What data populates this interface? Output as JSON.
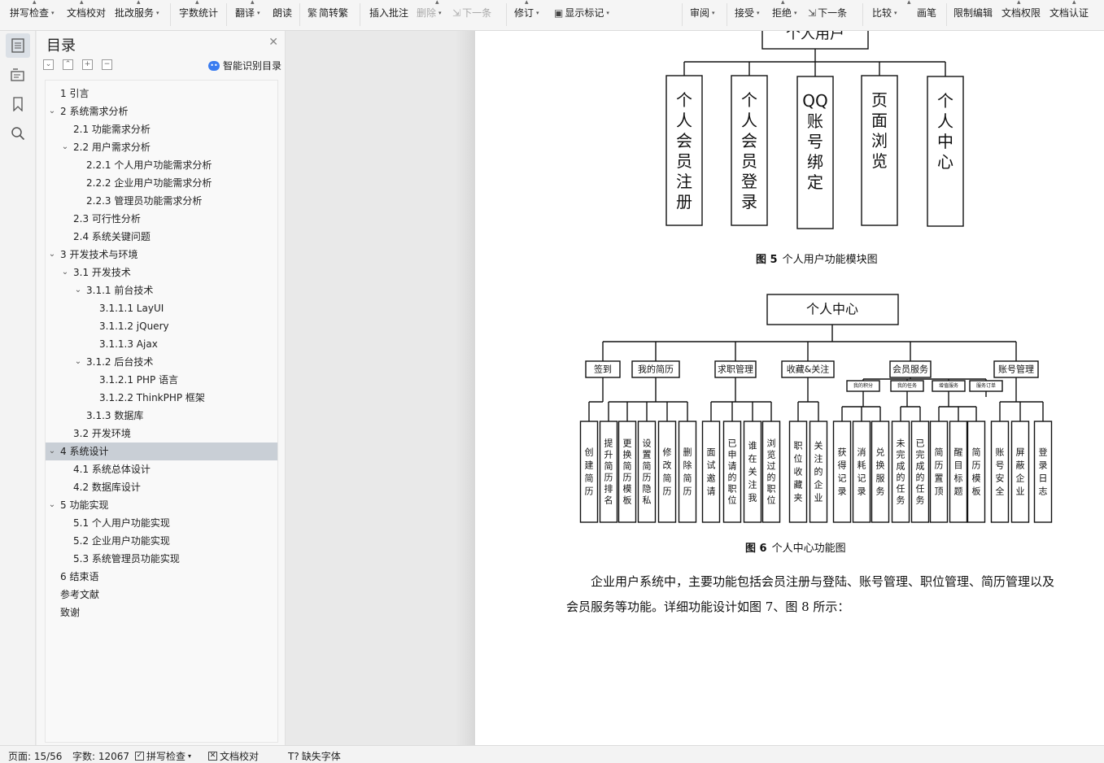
{
  "toolbar": {
    "items": [
      {
        "label": "拼写检查",
        "caret": true,
        "icon": "spellcheck-icon"
      },
      {
        "label": "文档校对",
        "caret": false,
        "icon": "proofread-icon"
      },
      {
        "label": "批改服务",
        "caret": true,
        "icon": "correction-icon"
      },
      {
        "label": "字数统计",
        "caret": false,
        "icon": "wordcount-icon"
      },
      {
        "label": "翻译",
        "caret": true,
        "icon": "translate-icon"
      },
      {
        "label": "朗读",
        "caret": false,
        "icon": "read-aloud-icon"
      },
      {
        "label": "简转繁",
        "caret": false,
        "icon": "simp-trad-icon"
      },
      {
        "label": "插入批注",
        "caret": false,
        "icon": "insert-comment-icon"
      },
      {
        "label": "删除",
        "caret": true,
        "icon": "delete-comment-icon",
        "disabled": true
      },
      {
        "label": "下一条",
        "caret": false,
        "icon": "next-comment-icon",
        "disabled": true
      },
      {
        "label": "修订",
        "caret": true,
        "icon": "revise-icon"
      },
      {
        "label": "显示标记",
        "caret": true,
        "icon": "show-markup-icon"
      },
      {
        "label": "审阅",
        "caret": true,
        "icon": "review-icon"
      },
      {
        "label": "接受",
        "caret": true,
        "icon": "accept-icon"
      },
      {
        "label": "拒绝",
        "caret": true,
        "icon": "reject-icon"
      },
      {
        "label": "下一条",
        "caret": false,
        "icon": "next-change-icon"
      },
      {
        "label": "比较",
        "caret": true,
        "icon": "compare-icon"
      },
      {
        "label": "画笔",
        "caret": false,
        "icon": "pen-icon"
      },
      {
        "label": "限制编辑",
        "caret": false,
        "icon": "restrict-edit-icon"
      },
      {
        "label": "文档权限",
        "caret": false,
        "icon": "doc-permission-icon"
      },
      {
        "label": "文档认证",
        "caret": false,
        "icon": "doc-certify-icon"
      }
    ]
  },
  "rail": {
    "buttons": [
      "toc-icon",
      "outline-icon",
      "bookmark-icon",
      "search-icon"
    ]
  },
  "toc": {
    "title": "目录",
    "smart_label": "智能识别目录",
    "items": [
      {
        "label": "1 引言",
        "level": 0,
        "chev": false
      },
      {
        "label": "2 系统需求分析",
        "level": 0,
        "chev": true
      },
      {
        "label": "2.1 功能需求分析",
        "level": 1,
        "chev": false
      },
      {
        "label": "2.2 用户需求分析",
        "level": 1,
        "chev": true
      },
      {
        "label": "2.2.1 个人用户功能需求分析",
        "level": 2,
        "chev": false
      },
      {
        "label": "2.2.2 企业用户功能需求分析",
        "level": 2,
        "chev": false
      },
      {
        "label": "2.2.3 管理员功能需求分析",
        "level": 2,
        "chev": false
      },
      {
        "label": "2.3 可行性分析",
        "level": 1,
        "chev": false
      },
      {
        "label": "2.4 系统关键问题",
        "level": 1,
        "chev": false
      },
      {
        "label": "3 开发技术与环境",
        "level": 0,
        "chev": true
      },
      {
        "label": "3.1 开发技术",
        "level": 1,
        "chev": true
      },
      {
        "label": "3.1.1 前台技术",
        "level": 2,
        "chev": true
      },
      {
        "label": "3.1.1.1 LayUI",
        "level": 3,
        "chev": false
      },
      {
        "label": "3.1.1.2 jQuery",
        "level": 3,
        "chev": false
      },
      {
        "label": "3.1.1.3 Ajax",
        "level": 3,
        "chev": false
      },
      {
        "label": "3.1.2 后台技术",
        "level": 2,
        "chev": true
      },
      {
        "label": "3.1.2.1 PHP 语言",
        "level": 3,
        "chev": false
      },
      {
        "label": "3.1.2.2 ThinkPHP 框架",
        "level": 3,
        "chev": false
      },
      {
        "label": "3.1.3 数据库",
        "level": 2,
        "chev": false
      },
      {
        "label": "3.2 开发环境",
        "level": 1,
        "chev": false
      },
      {
        "label": "4 系统设计",
        "level": 0,
        "chev": true,
        "selected": true
      },
      {
        "label": "4.1 系统总体设计",
        "level": 1,
        "chev": false
      },
      {
        "label": "4.2 数据库设计",
        "level": 1,
        "chev": false
      },
      {
        "label": "5 功能实现",
        "level": 0,
        "chev": true
      },
      {
        "label": "5.1 个人用户功能实现",
        "level": 1,
        "chev": false
      },
      {
        "label": "5.2 企业用户功能实现",
        "level": 1,
        "chev": false
      },
      {
        "label": "5.3 系统管理员功能实现",
        "level": 1,
        "chev": false
      },
      {
        "label": "6 结束语",
        "level": 0,
        "chev": false
      },
      {
        "label": "参考文献",
        "level": 0,
        "chev": false
      },
      {
        "label": "致谢",
        "level": 0,
        "chev": false
      }
    ]
  },
  "doc": {
    "fig5": {
      "root": "个人用户",
      "children": [
        "个人会员注册",
        "个人会员登录",
        "QQ账号绑定",
        "页面浏览",
        "个人中心"
      ],
      "caption_num": "图 5",
      "caption_text": "个人用户功能模块图"
    },
    "fig6": {
      "root": "个人中心",
      "groups": [
        {
          "label": "签到",
          "leaves": [
            "创建简历"
          ]
        },
        {
          "label": "我的简历",
          "leaves": [
            "提升简历排名",
            "更换简历模板",
            "设置简历隐私",
            "修改简历",
            "删除简历"
          ]
        },
        {
          "label": "求职管理",
          "leaves": [
            "面试邀请",
            "已申请的职位",
            "谁在关注我",
            "浏览过的职位"
          ]
        },
        {
          "label": "收藏&关注",
          "leaves": [
            "职位收藏夹",
            "关注的企业"
          ]
        },
        {
          "label": "会员服务",
          "sub": [
            "我的积分",
            "我的任务",
            "增值服务",
            "服务订单"
          ],
          "leaves": [
            "获得记录",
            "消耗记录",
            "兑换服务",
            "未完成的任务",
            "已完成的任务",
            "简历置顶",
            "醒目标题",
            "简历模板"
          ]
        },
        {
          "label": "账号管理",
          "leaves": [
            "账号安全",
            "屏蔽企业",
            "登录日志"
          ]
        }
      ],
      "caption_num": "图 6",
      "caption_text": "个人中心功能图"
    },
    "paragraph": "企业用户系统中，主要功能包括会员注册与登陆、账号管理、职位管理、简历管理以及会员服务等功能。详细功能设计如图 7、图 8 所示："
  },
  "status": {
    "page": "页面: 15/56",
    "words": "字数: 12067",
    "spell": "拼写检查",
    "proof": "文档校对",
    "missing_font": "缺失字体"
  }
}
